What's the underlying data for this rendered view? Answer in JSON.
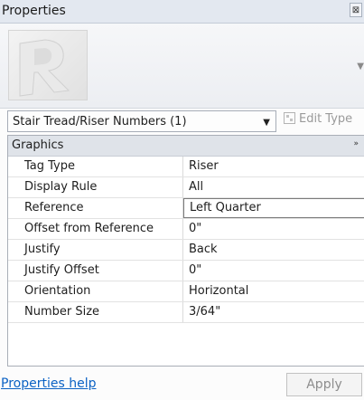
{
  "titlebar": {
    "title": "Properties",
    "close_glyph": "⊠"
  },
  "type_selector": {
    "value": "Stair Tread/Riser Numbers (1)",
    "caret": "▼",
    "edit_type_label": "Edit Type"
  },
  "group": {
    "label": "Graphics",
    "collapse_glyph": "»"
  },
  "properties": [
    {
      "name": "Tag Type",
      "value": "Riser"
    },
    {
      "name": "Display Rule",
      "value": "All"
    },
    {
      "name": "Reference",
      "value": "Left Quarter"
    },
    {
      "name": "Offset from Reference",
      "value": "0\""
    },
    {
      "name": "Justify",
      "value": "Back"
    },
    {
      "name": "Justify Offset",
      "value": "0\""
    },
    {
      "name": "Orientation",
      "value": "Horizontal"
    },
    {
      "name": "Number Size",
      "value": "3/64\""
    }
  ],
  "footer": {
    "help_link": "Properties help",
    "apply_label": "Apply"
  },
  "colors": {
    "link": "#0b62c4",
    "group_header_bg": "#dfe3e9",
    "titlebar_bg": "#e3e8f0"
  },
  "icons": {
    "close": "close-icon",
    "type_thumbnail": "revit-logo-icon",
    "dropdown": "chevron-down-icon",
    "edit_type": "edit-type-icon",
    "collapse": "collapse-icon"
  }
}
